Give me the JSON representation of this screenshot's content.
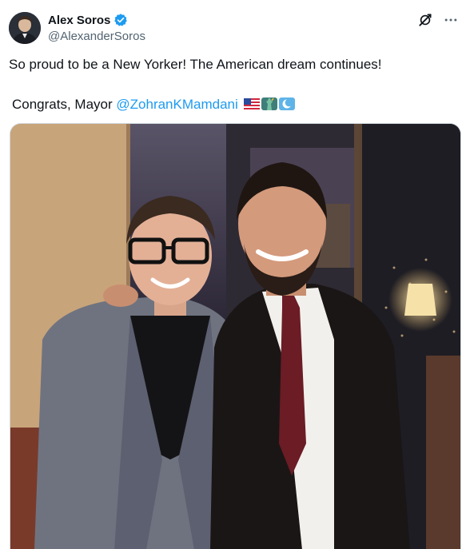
{
  "author": {
    "display_name": "Alex Soros",
    "handle": "@AlexanderSoros",
    "verified": true,
    "verified_color": "#1d9bf0"
  },
  "post": {
    "line1": "So proud to be a New Yorker! The American dream continues!",
    "line2_prefix": "Congrats, Mayor ",
    "mention": "@ZohranKMamdani",
    "emojis": [
      "us-flag-emoji",
      "statue-of-liberty-emoji",
      "crescent-moon-emoji"
    ]
  },
  "icons": {
    "grok": "grok-icon",
    "more": "more-icon"
  },
  "colors": {
    "text": "#0f1419",
    "secondary": "#536471",
    "link": "#1d9bf0"
  },
  "media": {
    "type": "photo"
  }
}
